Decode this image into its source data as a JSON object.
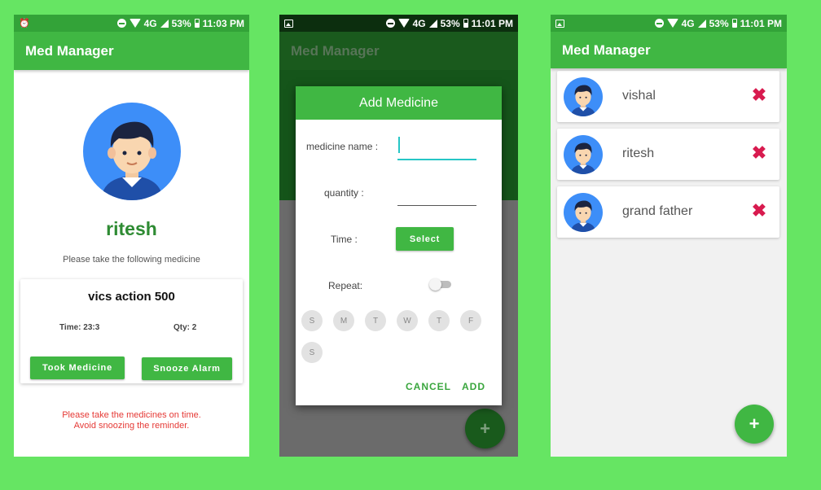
{
  "colors": {
    "background": "#66e563",
    "primary": "#40b743",
    "primary_dark": "#33a338",
    "accent_red": "#d81b4f",
    "warning_red": "#e53935",
    "name_green": "#2e8b33",
    "cursor_teal": "#26c6c6"
  },
  "status_bar": {
    "network": "4G",
    "battery": "53%",
    "time_1": "11:03 PM",
    "time_2": "11:01 PM",
    "time_3": "11:01 PM",
    "icons": [
      "alarm-icon",
      "image-icon",
      "dnd-icon",
      "wifi-icon",
      "signal-icon",
      "battery-icon"
    ]
  },
  "app": {
    "title": "Med Manager"
  },
  "reminder_screen": {
    "user_name": "ritesh",
    "subtitle": "Please take the following medicine",
    "medicine": {
      "name": "vics action 500",
      "time": "Time: 23:3",
      "qty": "Qty: 2"
    },
    "took_button": "Took Medicine",
    "snooze_button": "Snooze Alarm",
    "warning_line1": "Please take the medicines on time.",
    "warning_line2": "Avoid snoozing the reminder."
  },
  "add_medicine_dialog": {
    "title": "Add Medicine",
    "name_label": "medicine name :",
    "name_value": "",
    "quantity_label": "quantity :",
    "quantity_value": "",
    "time_label": "Time :",
    "select_button": "Select",
    "repeat_label": "Repeat:",
    "repeat_on": false,
    "days": [
      "S",
      "M",
      "T",
      "W",
      "T",
      "F",
      "S"
    ],
    "cancel": "CANCEL",
    "add": "ADD",
    "fab_icon": "+"
  },
  "users_screen": {
    "users": [
      {
        "name": "vishal"
      },
      {
        "name": "ritesh"
      },
      {
        "name": "grand father"
      }
    ],
    "delete_icon": "✖",
    "fab_icon": "+"
  }
}
